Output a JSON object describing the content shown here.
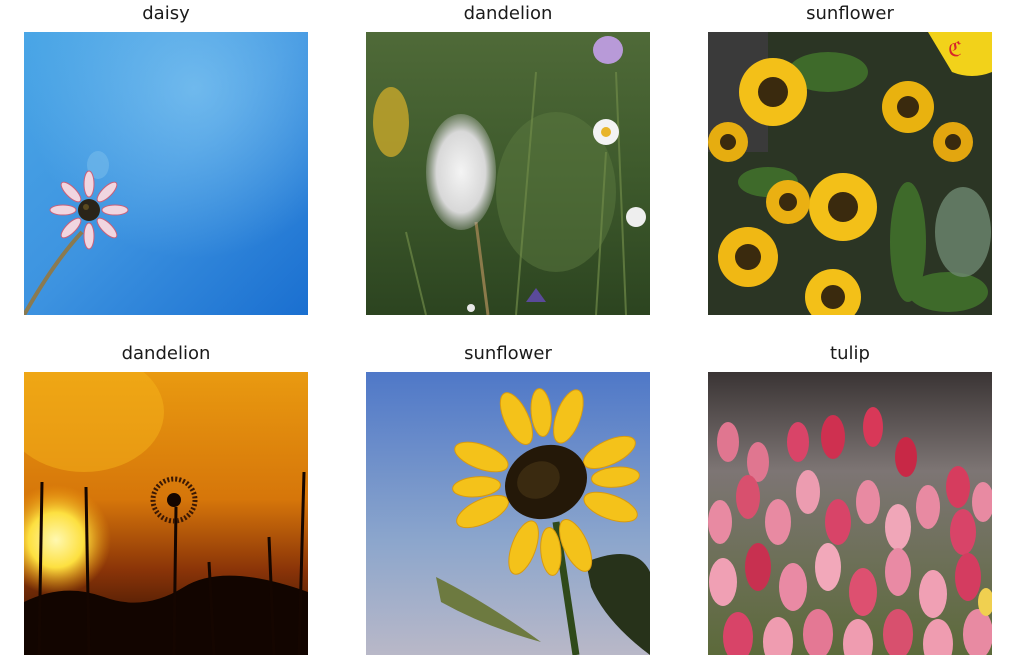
{
  "panels": [
    {
      "label": "daisy"
    },
    {
      "label": "dandelion"
    },
    {
      "label": "sunflower"
    },
    {
      "label": "dandelion"
    },
    {
      "label": "sunflower"
    },
    {
      "label": "tulip"
    }
  ]
}
